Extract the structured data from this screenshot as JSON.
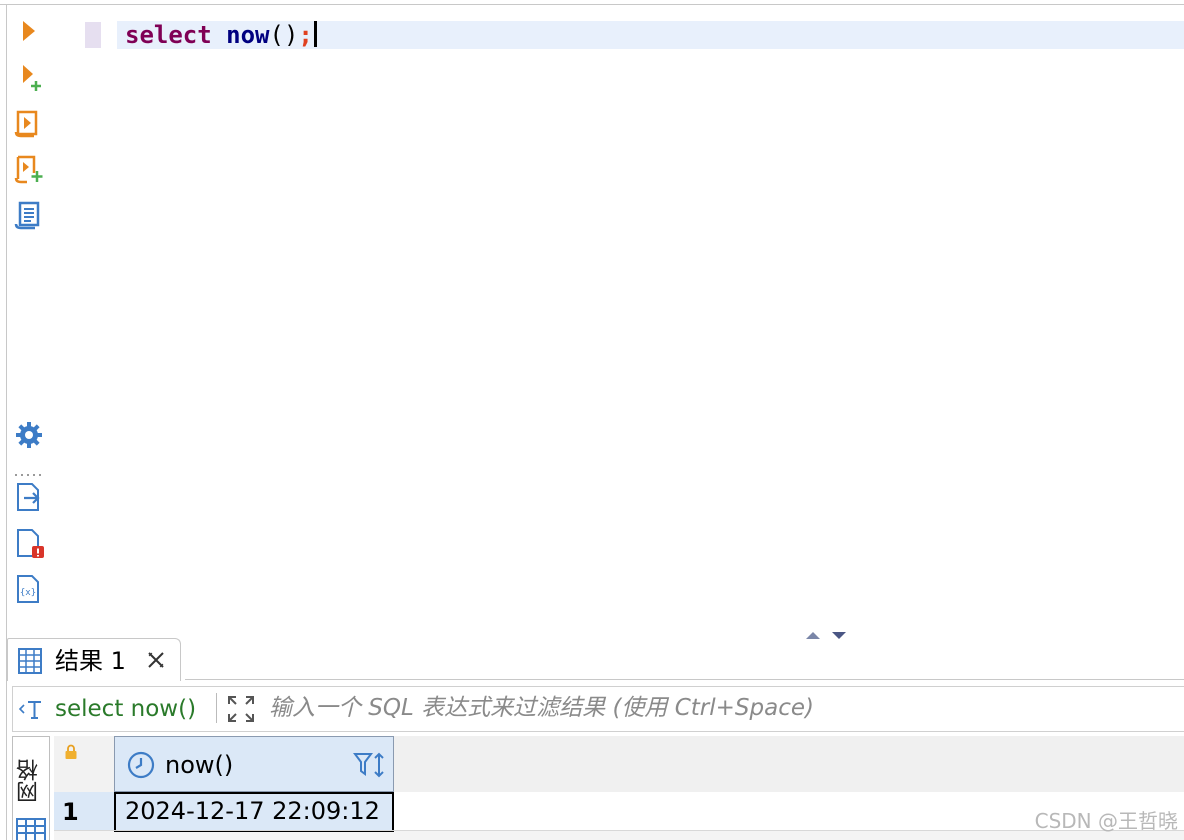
{
  "editor": {
    "code": {
      "keyword": "select",
      "function": "now",
      "parens": "()",
      "terminator": ";"
    },
    "toolbar": [
      {
        "name": "execute-statement",
        "icon": "play-icon"
      },
      {
        "name": "execute-in-new-tab",
        "icon": "play-plus-icon"
      },
      {
        "name": "execute-script",
        "icon": "script-play-icon"
      },
      {
        "name": "execute-script-new-tab",
        "icon": "script-play-plus-icon"
      },
      {
        "name": "explain-plan",
        "icon": "script-document-icon"
      },
      {
        "name": "settings",
        "icon": "gear-icon"
      },
      {
        "name": "export",
        "icon": "export-file-icon"
      },
      {
        "name": "problems",
        "icon": "file-error-icon"
      },
      {
        "name": "variables",
        "icon": "variables-file-icon"
      }
    ],
    "variables_icon_text": "{x}"
  },
  "results": {
    "tab_label": "结果 1",
    "filter": {
      "query": "select now()",
      "placeholder": "输入一个 SQL 表达式来过滤结果 (使用 Ctrl+Space)"
    },
    "side_tab_label": "网格",
    "columns": [
      {
        "name": "now()",
        "type_icon": "clock-icon"
      }
    ],
    "rows": [
      {
        "num": "1",
        "cells": [
          "2024-12-17 22:09:12"
        ]
      }
    ]
  },
  "watermark": "CSDN @王哲晓",
  "colors": {
    "keyword": "#7f0055",
    "function": "#000080",
    "current_line": "#e8f0fc",
    "selected_cell": "#dbe8f7",
    "filter_query": "#2a7a2a",
    "icon_orange": "#e8881e",
    "icon_blue": "#3d7cc6"
  }
}
